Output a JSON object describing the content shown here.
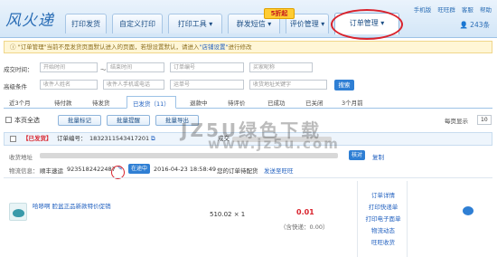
{
  "brand": {
    "logo": "风火递"
  },
  "nav": {
    "tabs": [
      {
        "label": "打印发货"
      },
      {
        "label": "自定义打印"
      },
      {
        "label": "打印工具 ▾"
      },
      {
        "label": "群发短信 ▾"
      },
      {
        "label": "评价管理 ▾"
      },
      {
        "label": "订单管理 ▾"
      }
    ],
    "promo_badge": "5折起",
    "top_links": [
      "手机版",
      "旺旺群",
      "客服",
      "帮助"
    ],
    "user_quota": "243条"
  },
  "notice": {
    "text": "\"订单管理\"当前不是发货页面默认进入的页面，若想设置默认，请进入",
    "link": "\"店铺设置\"",
    "suffix": "进行修改"
  },
  "search": {
    "row1": {
      "label": "成交时间：",
      "start_placeholder": "开始时间",
      "to": "～",
      "end_placeholder": "结束时间",
      "order_placeholder": "订单编号",
      "buyer_placeholder": "买家昵称"
    },
    "row2": {
      "label": "高级条件",
      "name_placeholder": "收件人姓名",
      "phone_placeholder": "收件人手机或电话",
      "waybill_placeholder": "运单号",
      "addr_placeholder": "收货地址关键字",
      "button": "搜索"
    }
  },
  "status_tabs": [
    "近3个月",
    "待付款",
    "待发货",
    "已发货（11）",
    "退款中",
    "待评价",
    "已成功",
    "已关闭",
    "3个月前"
  ],
  "actions": {
    "select_all": "本页全选",
    "btn_mark": "批量标记",
    "btn_reminder": "批量提醒",
    "btn_export": "批量导出",
    "per_page_label": "每页显示",
    "per_page_value": "10"
  },
  "watermark": {
    "line1": "JZ5U绿色下载",
    "line2": "www.jz5u.com"
  },
  "order": {
    "status_tag": "【已发货】",
    "order_no_label": "订单编号：",
    "order_no": "1832311543417201",
    "deal_time_label": "成交",
    "address_label": "收货地址",
    "verify_btn": "核对",
    "copy_btn": "复制",
    "logistics_label": "物流信息：",
    "logistics_company": "顺丰速运",
    "logistics_no": "9235182422487",
    "in_transit": "在途中",
    "logistics_time": "2016-04-23 18:58:49",
    "logistics_msg": "您的订单待配货",
    "send_to_wang": "发送至旺旺",
    "item_title": "哈哆啊 脸盆正品新款特价促销",
    "price": "510.02 × 1",
    "total": "0.01",
    "shipping": "（含快递：0.00）",
    "side_links": [
      "订单详情",
      "打印快递单",
      "打印电子面单",
      "物流动态",
      "旺旺收货"
    ]
  }
}
